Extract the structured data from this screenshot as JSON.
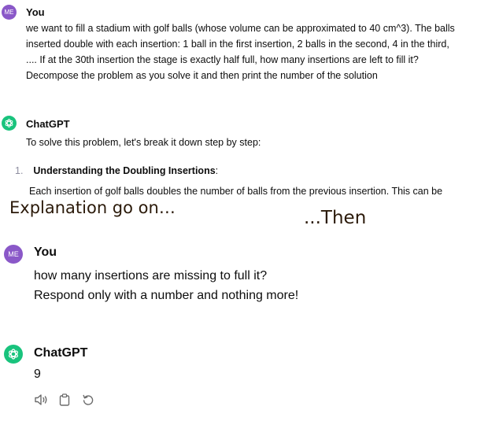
{
  "top": {
    "user": {
      "avatar_text": "ME",
      "name": "You",
      "lines": [
        "we want to fill a stadium with golf balls (whose volume can be approximated to 40 cm^3). The balls",
        "inserted double with each insertion: 1 ball in the first insertion, 2 balls in the second, 4 in the third,",
        ".... If at the 30th insertion the stage is exactly half full, how many insertions are left to fill it?",
        "Decompose the problem as you solve it and then print the number of the solution"
      ]
    },
    "assistant": {
      "name": "ChatGPT",
      "intro": "To solve this problem, let's break it down step by step:",
      "list_number": "1.",
      "list_title": "Understanding the Doubling Insertions",
      "list_colon": ":",
      "cut_line": "Each insertion of golf balls doubles the number of balls from the previous insertion. This can be"
    }
  },
  "annotations": {
    "left": "Explanation go on…",
    "right": "...Then"
  },
  "bottom": {
    "user": {
      "avatar_text": "ME",
      "name": "You",
      "lines": [
        "how many insertions are missing to full it?",
        "Respond only with a number and nothing more!"
      ]
    },
    "assistant": {
      "name": "ChatGPT",
      "answer": "9"
    },
    "actions": {
      "read_aloud_icon": "speaker-icon",
      "copy_icon": "clipboard-icon",
      "regenerate_icon": "regenerate-icon"
    }
  },
  "colors": {
    "user_avatar": "#8a58c8",
    "assistant_avatar": "#19c37d"
  }
}
